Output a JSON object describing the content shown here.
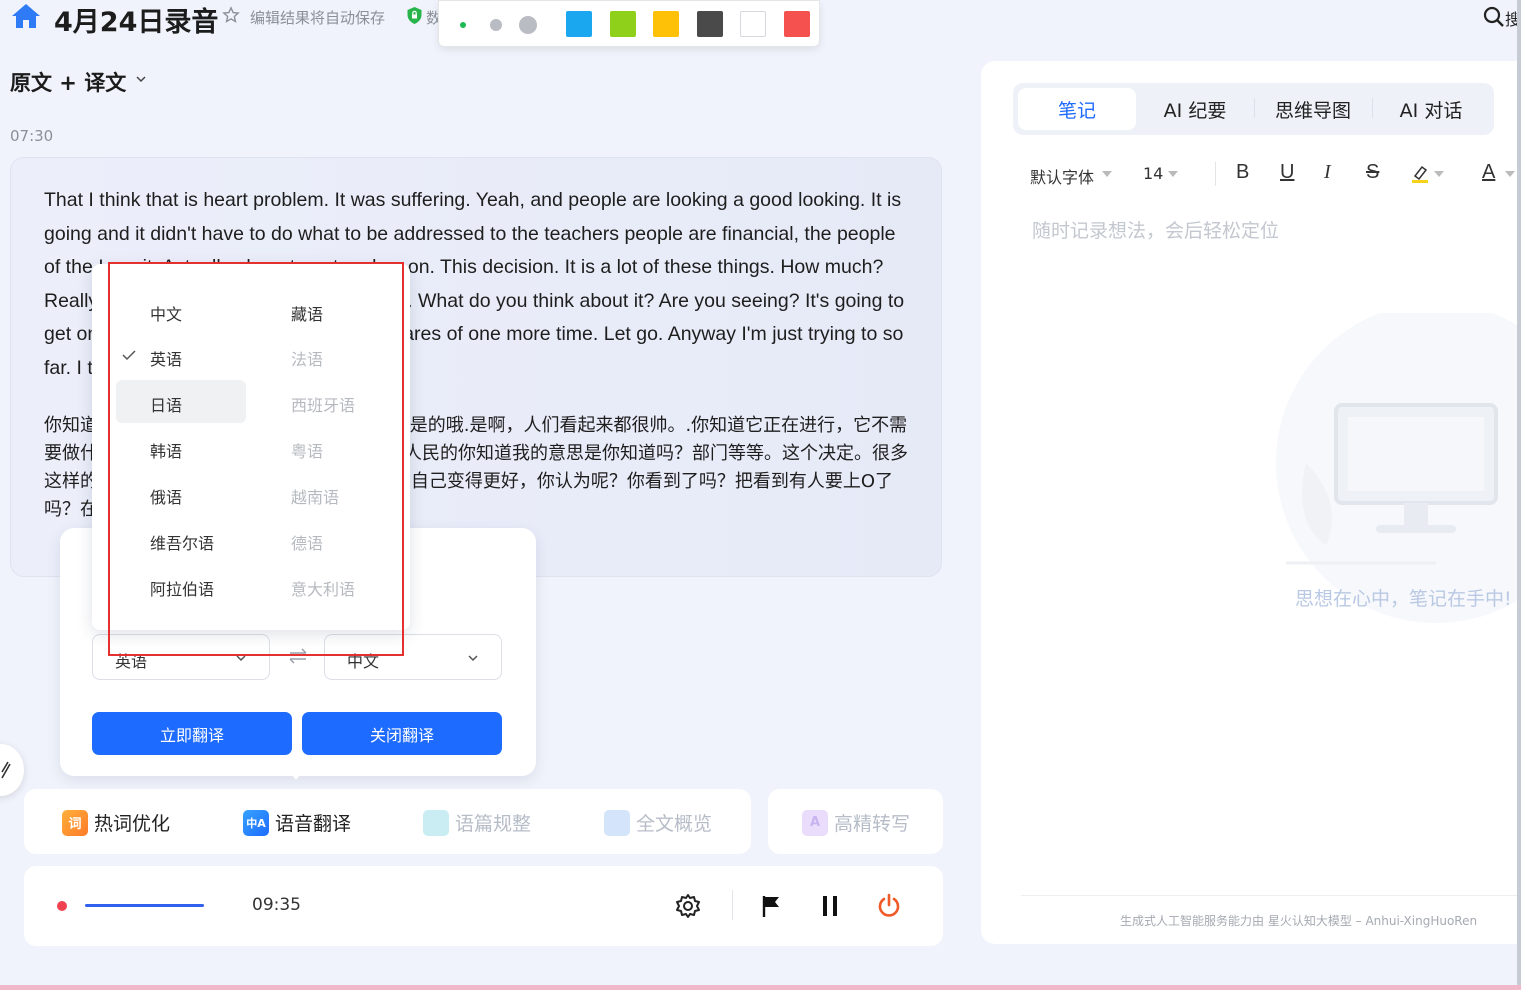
{
  "header": {
    "title": "4月24日录音",
    "autosave": "编辑结果将自动保存",
    "shield_text": "数",
    "search_label": "搜"
  },
  "palette": {
    "dot_sizes": [
      "small",
      "medium",
      "large"
    ],
    "colors": [
      "#1aa7f0",
      "#8fd11a",
      "#ffc107",
      "#4a4a4a",
      "#ffffff",
      "#f4514f"
    ]
  },
  "left": {
    "view_mode": "原文 + 译文",
    "timestamp": "07:30",
    "transcript_en": " That I think that is heart problem. It was suffering. Yeah, and people are looking a good looking.  It is going and it didn't have to do what to be addressed to the teachers people are financial, the people of the I are it. Actually, department and so on. This decision. It is a lot of these things. How much? Really? You got to make a lot of ourselves. What do you think about it? Are you seeing? It's going to get on the O to be off on the Top of the shares of one more time. Let go. Anyway I'm just trying to so far. I think the way is what is the people.",
    "transcript_zh": "你知道我认为那是心脏的问题.很痛苦是的是的是的哦.是啊，人们看起来都很帅。.你知道它正在进行，它不需要做什么被对老师们说什么吗？都是财政的，人民的你知道我的意思是你知道吗？部门等等。这个决定。很多这样的事情。.你知道多少？?真的?你得让我们自己变得更好，你认为呢？你看到了吗？把看到有人要上O了吗？在...的股票之上再一次哦，继续往前走。"
  },
  "translate": {
    "source_lang": "英语",
    "target_lang": "中文",
    "translate_now": "立即翻译",
    "close_translate": "关闭翻译"
  },
  "lang_dropdown": {
    "col1": [
      "中文",
      "英语",
      "日语",
      "韩语",
      "俄语",
      "维吾尔语",
      "阿拉伯语"
    ],
    "col2": [
      "藏语",
      "法语",
      "西班牙语",
      "粤语",
      "越南语",
      "德语",
      "意大利语"
    ],
    "selected": "英语",
    "hovered": "日语"
  },
  "tools": {
    "hotword": "热词优化",
    "hotword_icon": "词",
    "voice_translate": "语音翻译",
    "voice_translate_icon": "中A",
    "paragraph": "语篇规整",
    "overview": "全文概览",
    "hq_transcribe": "高精转写",
    "hq_icon": "A"
  },
  "recording": {
    "elapsed": "09:35"
  },
  "right": {
    "tabs": [
      "笔记",
      "AI 纪要",
      "思维导图",
      "AI 对话"
    ],
    "active_tab": "笔记",
    "font_name": "默认字体",
    "font_size": "14",
    "bold": "B",
    "underline": "U",
    "italic": "I",
    "strike": "S",
    "text_color": "A",
    "placeholder": "随时记录想法，会后轻松定位",
    "empty_text": "思想在心中，笔记在手中!",
    "footer": "生成式人工智能服务能力由 星火认知大模型 – Anhui-XingHuoRen"
  }
}
